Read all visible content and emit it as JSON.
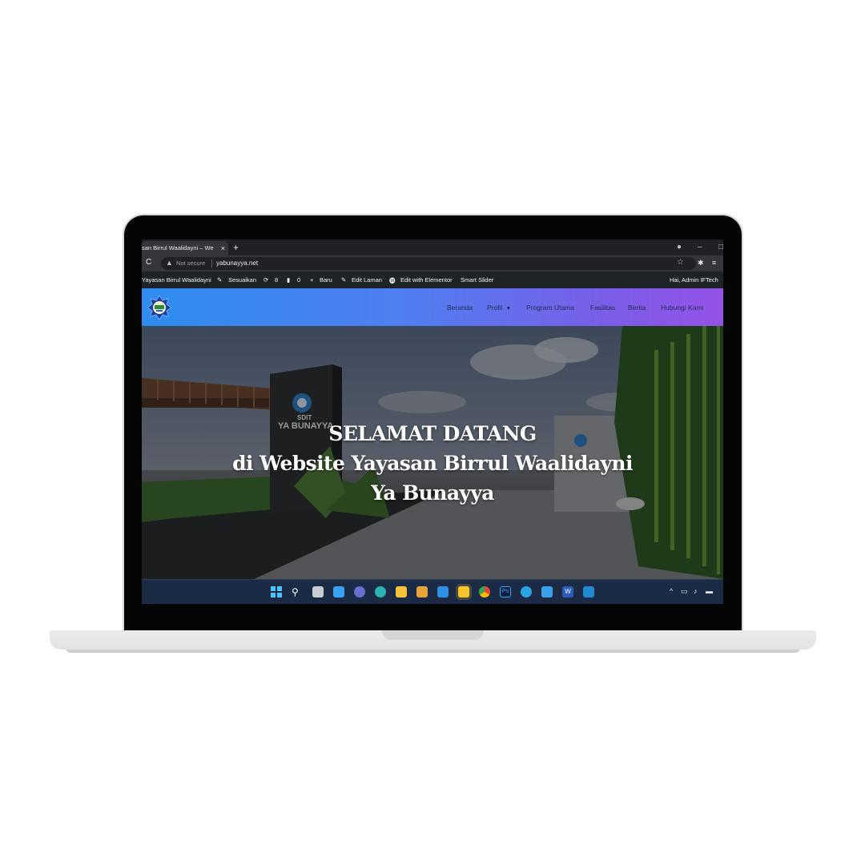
{
  "browser": {
    "tab_title": "san Birrul Waalidayni – Webs",
    "tab_close": "×",
    "new_tab": "+",
    "not_secure": "Not secure",
    "url": "yabunayya.net"
  },
  "wp_admin_bar": {
    "site_name": "Yayasan Birrul Waalidayni",
    "customize": "Sesuaikan",
    "updates_count": "8",
    "comments_count": "0",
    "new_label": "Baru",
    "edit_page": "Edit Laman",
    "edit_elementor": "Edit with Elementor",
    "smart_slider": "Smart Slider",
    "greeting": "Hai, Admin IFTech"
  },
  "site_nav": {
    "items": [
      "Beranda",
      "Profil",
      "Program Utama",
      "Fasilitas",
      "Berita",
      "Hubungi Kami"
    ]
  },
  "hero": {
    "line1": "SELAMAT DATANG",
    "line2": "di Website Yayasan Birrul Waalidayni",
    "line3": "Ya Bunayya",
    "sign_small": "SDIT",
    "sign_large": "YA BUNAYYA"
  },
  "taskbar": {
    "icons": [
      "start-icon",
      "search-icon",
      "task-view-icon",
      "widgets-icon",
      "teams-icon",
      "edge-icon",
      "file-explorer-icon",
      "store-icon",
      "mail-icon",
      "sticky-notes-icon",
      "chrome-icon",
      "photoshop-icon",
      "telegram-icon",
      "notepad-icon",
      "word-icon",
      "vscode-icon"
    ],
    "photoshop_label": "Ps",
    "word_label": "W"
  },
  "colors": {
    "header_start": "#2e8df0",
    "header_end": "#9552e6",
    "taskbar": "#1b2a45",
    "chrome_dark": "#202124"
  }
}
